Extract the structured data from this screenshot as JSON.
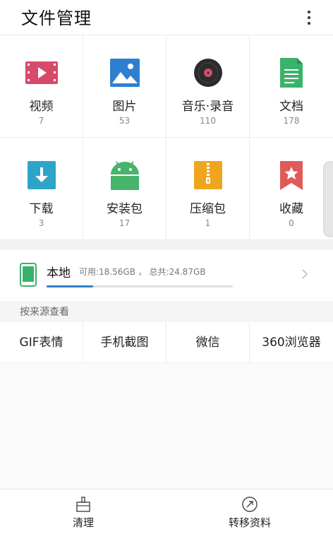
{
  "header": {
    "title": "文件管理",
    "menu_icon": "more-vertical-icon"
  },
  "categories": [
    {
      "label": "视频",
      "count": "7",
      "icon": "video-icon",
      "color": "#d64a6a"
    },
    {
      "label": "图片",
      "count": "53",
      "icon": "image-icon",
      "color": "#2f7fd0"
    },
    {
      "label": "音乐·录音",
      "count": "110",
      "icon": "music-disc-icon",
      "color": "#2b2b2b"
    },
    {
      "label": "文档",
      "count": "178",
      "icon": "document-icon",
      "color": "#3bb26a"
    },
    {
      "label": "下载",
      "count": "3",
      "icon": "download-icon",
      "color": "#2ea5c8"
    },
    {
      "label": "安装包",
      "count": "17",
      "icon": "android-icon",
      "color": "#48b36a"
    },
    {
      "label": "压缩包",
      "count": "1",
      "icon": "zip-icon",
      "color": "#f0a51f"
    },
    {
      "label": "收藏",
      "count": "0",
      "icon": "bookmark-star-icon",
      "color": "#e05a5a"
    }
  ],
  "storage": {
    "name": "本地",
    "available_label": "可用:18.56GB ，  总共:24.87GB",
    "used_fraction": 0.25,
    "accent": "#2f80c9",
    "icon": "phone-icon"
  },
  "sources": {
    "section_label": "按来源查看",
    "items": [
      "GIF表情",
      "手机截图",
      "微信",
      "360浏览器"
    ]
  },
  "bottom_bar": {
    "clean_label": "清理",
    "transfer_label": "转移资料"
  }
}
